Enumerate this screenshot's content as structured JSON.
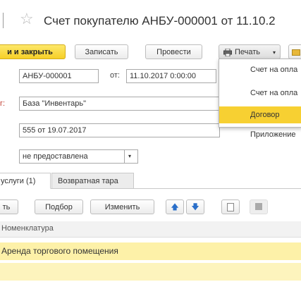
{
  "window": {
    "title": "Счет покупателю АНБУ-000001 от 11.10.2",
    "star_icon": "star-icon"
  },
  "toolbar": {
    "save_close_label": "и и закрыть",
    "save_label": "Записать",
    "post_label": "Провести",
    "print_label": "Печать",
    "print_icon": "printer-icon"
  },
  "print_menu": {
    "items": [
      "Счет на опла",
      "Счет на опла",
      "Договор",
      "Приложение"
    ],
    "highlight_color": "#f7d032"
  },
  "form": {
    "number_value": "АНБУ-000001",
    "date_label": "от:",
    "date_value": "11.10.2017  0:00:00",
    "base_label": "г:",
    "base_value": "База \"Инвентарь\"",
    "contract_value": "555 от 19.07.2017",
    "status_value": "не предоставлена"
  },
  "tabs": [
    {
      "label": "услуги (1)",
      "active": true
    },
    {
      "label": "Возвратная тара",
      "active": false
    }
  ],
  "table_toolbar": {
    "add_label": "ть",
    "select_label": "Подбор",
    "change_label": "Изменить"
  },
  "table": {
    "column_header": "Номенклатура",
    "rows": [
      "Аренда торгового помещения",
      ""
    ],
    "row_color": "#fdf1a8"
  },
  "colors": {
    "primary_button": "#f6cf26",
    "row_highlight": "#fdf1a8"
  }
}
